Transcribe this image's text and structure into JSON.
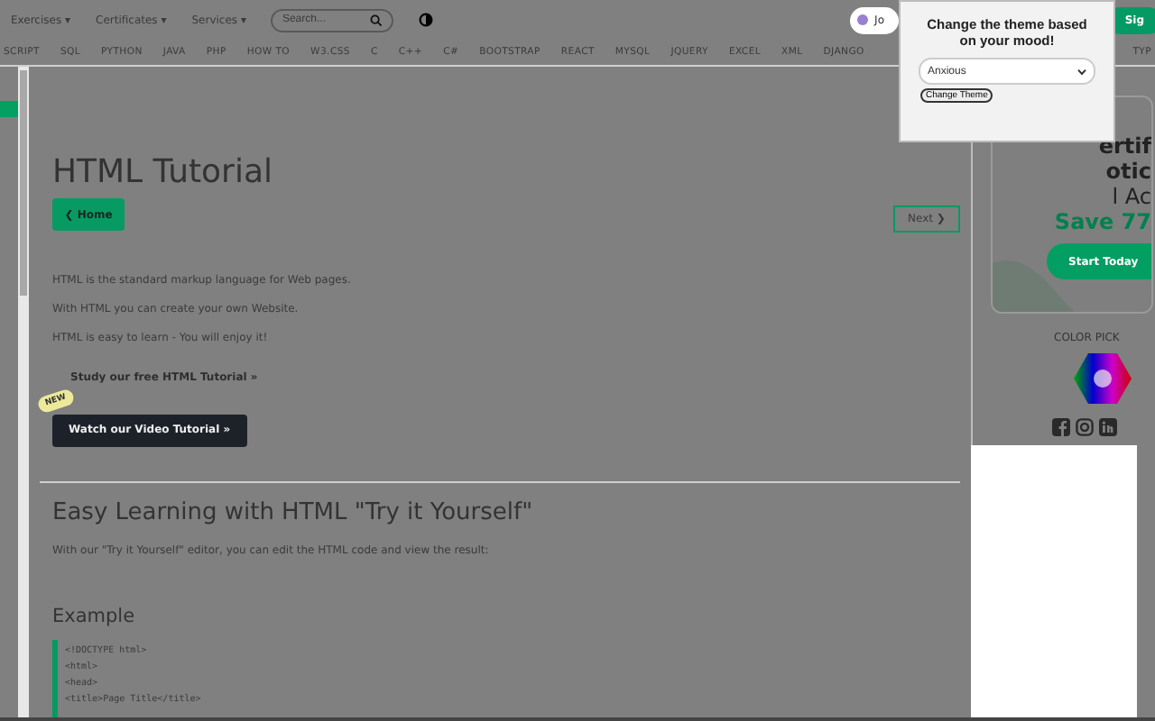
{
  "top_menu": [
    {
      "label": "Exercises ▾"
    },
    {
      "label": "Certificates ▾"
    },
    {
      "label": "Services ▾"
    }
  ],
  "search": {
    "placeholder": "Search..."
  },
  "account": {
    "label": "Jo"
  },
  "sign_button": {
    "label": "Sig"
  },
  "nav_tabs": [
    {
      "label": "SCRIPT"
    },
    {
      "label": "SQL"
    },
    {
      "label": "PYTHON"
    },
    {
      "label": "JAVA"
    },
    {
      "label": "PHP"
    },
    {
      "label": "HOW TO"
    },
    {
      "label": "W3.CSS"
    },
    {
      "label": "C"
    },
    {
      "label": "C++"
    },
    {
      "label": "C#"
    },
    {
      "label": "BOOTSTRAP"
    },
    {
      "label": "REACT"
    },
    {
      "label": "MYSQL"
    },
    {
      "label": "JQUERY"
    },
    {
      "label": "EXCEL"
    },
    {
      "label": "XML"
    },
    {
      "label": "DJANGO"
    }
  ],
  "nav_tab_end": {
    "label": "TYP"
  },
  "main": {
    "title": "HTML Tutorial",
    "home_button": "❮ Home",
    "next_button": "Next ❯",
    "paragraphs": [
      "HTML is the standard markup language for Web pages.",
      "With HTML you can create your own Website.",
      "HTML is easy to learn - You will enjoy it!"
    ],
    "study_link": "Study our free HTML Tutorial »",
    "new_badge": "NEW",
    "video_button": "Watch our Video Tutorial »",
    "section_title": "Easy Learning with HTML \"Try it Yourself\"",
    "section_text": "With our \"Try it Yourself\" editor, you can edit the HTML code and view the result:",
    "example_title": "Example",
    "code_lines": [
      "<!DOCTYPE html>",
      "<html>",
      "<head>",
      "<title>Page Title</title>"
    ]
  },
  "ad": {
    "lines": [
      "ertif",
      "otic",
      "l Ac"
    ],
    "offer": "Save 77",
    "button": "Start Today"
  },
  "color_picker": {
    "label": "COLOR PICK"
  },
  "theme_popup": {
    "title": "Change the theme based on your mood!",
    "select_value": "Anxious",
    "button": "Change Theme"
  }
}
